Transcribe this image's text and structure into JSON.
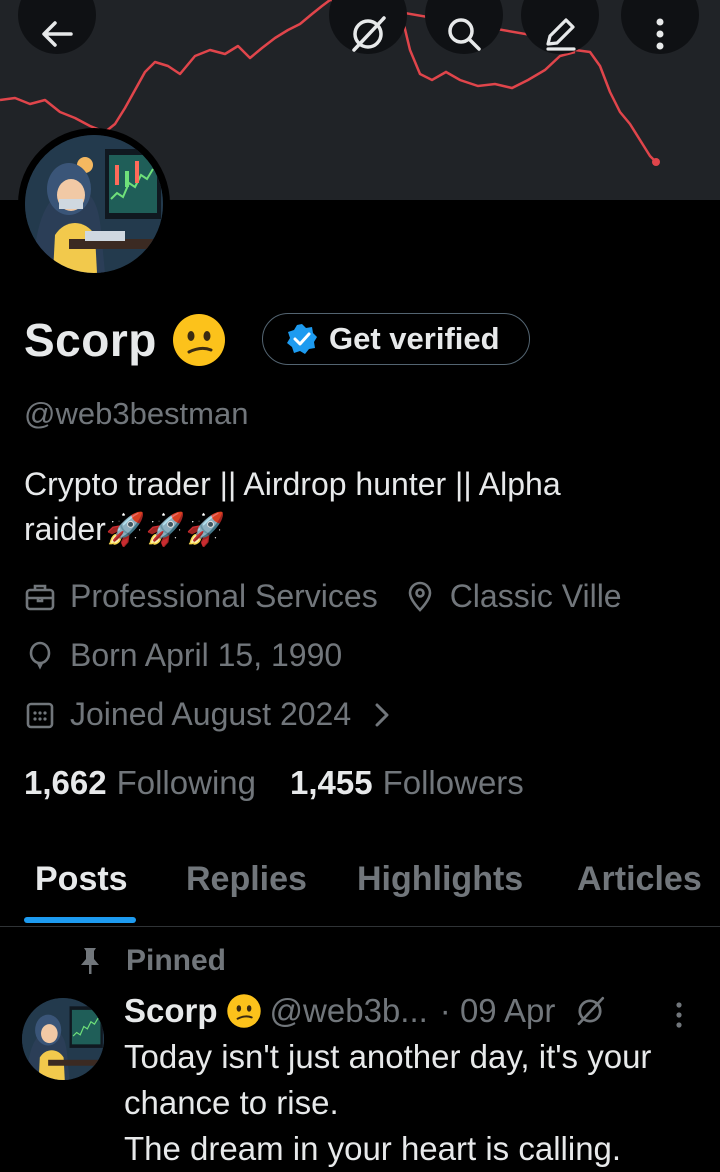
{
  "profile": {
    "name": "Scorp",
    "handle": "@web3bestman",
    "bio_line1": "Crypto trader || Airdrop hunter || Alpha",
    "bio_line2": "raider🚀🚀🚀",
    "category": "Professional Services",
    "location": "Classic Ville",
    "born": "Born April 15, 1990",
    "joined": "Joined August 2024",
    "following_count": "1,662",
    "following_label": "Following",
    "followers_count": "1,455",
    "followers_label": "Followers"
  },
  "verify_button": {
    "label": "Get verified"
  },
  "topbar": {
    "icons": [
      "back-arrow-icon",
      "grok-icon",
      "search-icon",
      "edit-icon",
      "more-vertical-icon"
    ]
  },
  "tabs": [
    {
      "label": "Posts",
      "active": true
    },
    {
      "label": "Replies",
      "active": false
    },
    {
      "label": "Highlights",
      "active": false
    },
    {
      "label": "Articles",
      "active": false
    }
  ],
  "pinned_post": {
    "pinned_label": "Pinned",
    "author_name": "Scorp",
    "author_handle": "@web3b...",
    "date": "· 09 Apr",
    "text_line1": "Today isn't just another day, it's your",
    "text_line2": "chance to rise.",
    "text_line3": "The dream in your heart is calling."
  },
  "colors": {
    "background": "#000000",
    "banner": "#202327",
    "banner_line": "#e0454b",
    "accent": "#1d9bf0",
    "muted_text": "#71767b",
    "primary_text": "#e7e9ea"
  }
}
